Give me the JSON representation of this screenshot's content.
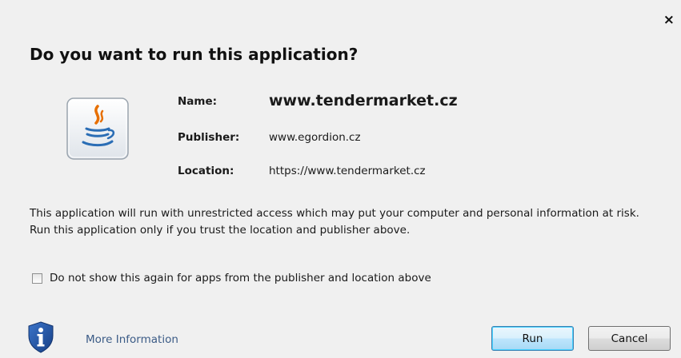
{
  "dialog": {
    "close_label": "×",
    "title": "Do you want to run this application?",
    "app_icon": "java-cup-icon",
    "fields": {
      "name_label": "Name:",
      "name_value": "www.tendermarket.cz",
      "publisher_label": "Publisher:",
      "publisher_value": "www.egordion.cz",
      "location_label": "Location:",
      "location_value": "https://www.tendermarket.cz"
    },
    "warning_text": "This application will run with unrestricted access which may put your computer and personal information at risk. Run this application only if you trust the location and publisher above.",
    "checkbox": {
      "label": "Do not show this again for apps from the publisher and location above",
      "checked": false
    },
    "footer": {
      "info_icon": "shield-info-icon",
      "more_info_label": "More Information",
      "run_label": "Run",
      "cancel_label": "Cancel"
    }
  },
  "colors": {
    "background": "#f0f0f0",
    "link": "#3b5b86",
    "run_border": "#3c7fb1",
    "java_orange": "#e76f00",
    "java_blue": "#2a6db5",
    "shield_blue": "#1e4fa0"
  }
}
